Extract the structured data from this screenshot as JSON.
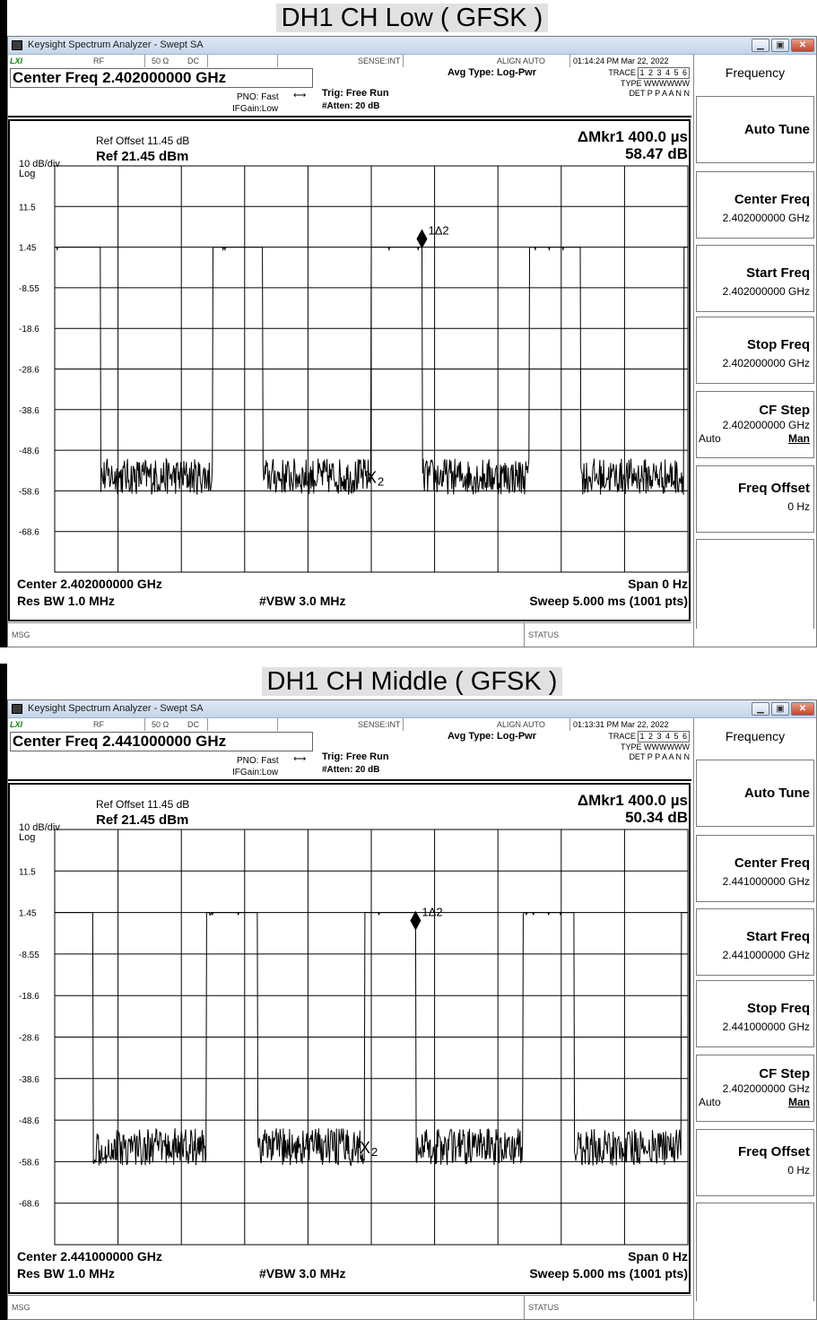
{
  "panels": [
    {
      "title": "DH1 CH Low ( GFSK )",
      "window_title": "Keysight Spectrum Analyzer - Swept SA",
      "header": {
        "rf": "RF",
        "impedance": "50 Ω",
        "coupling": "DC",
        "sense": "SENSE:INT",
        "align": "ALIGN AUTO",
        "timestamp": "01:14:24 PM Mar 22, 2022",
        "center_freq": "Center Freq 2.402000000 GHz",
        "pno": "PNO: Fast",
        "ifgain": "IFGain:Low",
        "trig": "Trig: Free Run",
        "atten": "#Atten: 20 dB",
        "avg_type": "Avg Type: Log-Pwr",
        "trace_label": "TRACE",
        "trace_nums": "1 2 3 4 5 6",
        "type_label": "TYPE",
        "type_vals": "WWWWWW",
        "det_label": "DET",
        "det_vals": "P P A A N N"
      },
      "plot": {
        "ref_offset": "Ref Offset 11.45 dB",
        "scale": "10 dB/div",
        "scale_type": "Log",
        "ref_level": "Ref 21.45 dBm",
        "marker_readout": "ΔMkr1 400.0 µs",
        "marker_value": "58.47 dB",
        "y_labels": [
          "11.5",
          "1.45",
          "-8.55",
          "-18.6",
          "-28.6",
          "-38.6",
          "-48.6",
          "-58.6",
          "-68.6"
        ],
        "marker1_label": "1Δ2",
        "marker2_label": "2",
        "footer_center": "Center 2.402000000 GHz",
        "footer_span": "Span 0 Hz",
        "footer_rbw": "Res BW 1.0 MHz",
        "footer_vbw": "#VBW 3.0 MHz",
        "footer_sweep": "Sweep  5.000 ms (1001 pts)"
      },
      "status": {
        "msg": "MSG",
        "status": "STATUS"
      },
      "softkeys": {
        "menu_title": "Frequency",
        "auto_tune": "Auto Tune",
        "center_freq": {
          "label": "Center Freq",
          "value": "2.402000000 GHz"
        },
        "start_freq": {
          "label": "Start Freq",
          "value": "2.402000000 GHz"
        },
        "stop_freq": {
          "label": "Stop Freq",
          "value": "2.402000000 GHz"
        },
        "cf_step": {
          "label": "CF Step",
          "value": "2.402000000 GHz",
          "auto": "Auto",
          "man": "Man"
        },
        "freq_offset": {
          "label": "Freq Offset",
          "value": "0 Hz"
        }
      },
      "chart_data": {
        "type": "line",
        "x_unit": "ms",
        "x_range": [
          0,
          5
        ],
        "ylim": [
          -78.55,
          21.45
        ],
        "pulse_high_dBm": 1.45,
        "noise_floor_dBm": -55,
        "pulses_ms": [
          [
            0,
            0.36
          ],
          [
            1.25,
            1.64
          ],
          [
            2.5,
            2.9
          ],
          [
            3.75,
            4.15
          ],
          [
            4.97,
            5.0
          ]
        ],
        "marker1_ms": 2.9,
        "marker1_dBm": 3.5,
        "marker2_ms": 2.5,
        "marker2_dBm": -55
      }
    },
    {
      "title": "DH1 CH Middle ( GFSK )",
      "window_title": "Keysight Spectrum Analyzer - Swept SA",
      "header": {
        "rf": "RF",
        "impedance": "50 Ω",
        "coupling": "DC",
        "sense": "SENSE:INT",
        "align": "ALIGN AUTO",
        "timestamp": "01:13:31 PM Mar 22, 2022",
        "center_freq": "Center Freq 2.441000000 GHz",
        "pno": "PNO: Fast",
        "ifgain": "IFGain:Low",
        "trig": "Trig: Free Run",
        "atten": "#Atten: 20 dB",
        "avg_type": "Avg Type: Log-Pwr",
        "trace_label": "TRACE",
        "trace_nums": "1 2 3 4 5 6",
        "type_label": "TYPE",
        "type_vals": "WWWWWW",
        "det_label": "DET",
        "det_vals": "P P A A N N"
      },
      "plot": {
        "ref_offset": "Ref Offset 11.45 dB",
        "scale": "10 dB/div",
        "scale_type": "Log",
        "ref_level": "Ref 21.45 dBm",
        "marker_readout": "ΔMkr1 400.0 µs",
        "marker_value": "50.34 dB",
        "y_labels": [
          "11.5",
          "1.45",
          "-8.55",
          "-18.6",
          "-28.6",
          "-38.6",
          "-48.6",
          "-58.6",
          "-68.6"
        ],
        "marker1_label": "1Δ2",
        "marker2_label": "2",
        "footer_center": "Center 2.441000000 GHz",
        "footer_span": "Span 0 Hz",
        "footer_rbw": "Res BW 1.0 MHz",
        "footer_vbw": "#VBW 3.0 MHz",
        "footer_sweep": "Sweep  5.000 ms (1001 pts)"
      },
      "status": {
        "msg": "MSG",
        "status": "STATUS"
      },
      "softkeys": {
        "menu_title": "Frequency",
        "auto_tune": "Auto Tune",
        "center_freq": {
          "label": "Center Freq",
          "value": "2.441000000 GHz"
        },
        "start_freq": {
          "label": "Start Freq",
          "value": "2.441000000 GHz"
        },
        "stop_freq": {
          "label": "Stop Freq",
          "value": "2.441000000 GHz"
        },
        "cf_step": {
          "label": "CF Step",
          "value": "2.402000000 GHz",
          "auto": "Auto",
          "man": "Man"
        },
        "freq_offset": {
          "label": "Freq Offset",
          "value": "0 Hz"
        }
      },
      "chart_data": {
        "type": "line",
        "x_unit": "ms",
        "x_range": [
          0,
          5
        ],
        "ylim": [
          -78.55,
          21.45
        ],
        "pulse_high_dBm": 1.45,
        "noise_floor_dBm": -55,
        "pulses_ms": [
          [
            0,
            0.3
          ],
          [
            1.2,
            1.6
          ],
          [
            2.45,
            2.85
          ],
          [
            3.7,
            4.1
          ],
          [
            4.95,
            5.0
          ]
        ],
        "marker1_ms": 2.85,
        "marker1_dBm": -0.5,
        "marker2_ms": 2.45,
        "marker2_dBm": -55
      }
    }
  ]
}
